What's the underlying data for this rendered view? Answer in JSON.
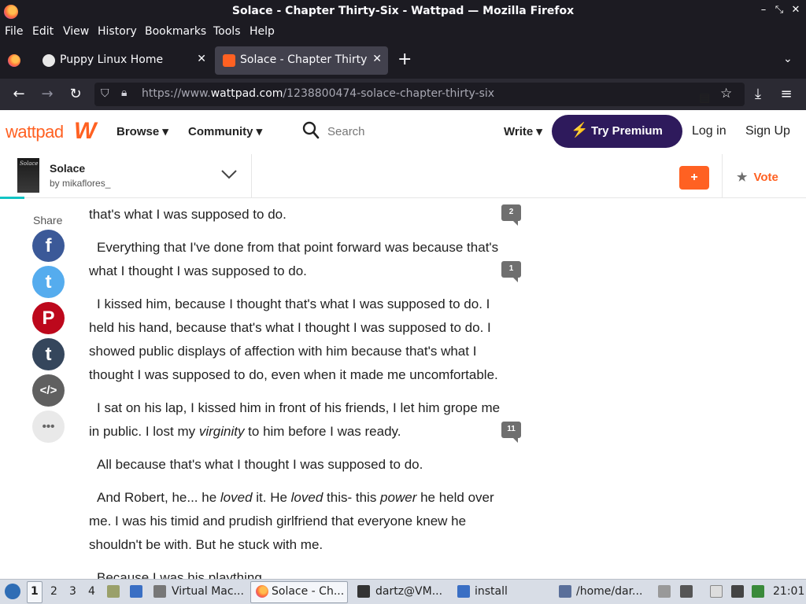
{
  "window": {
    "title": "Solace - Chapter Thirty-Six - Wattpad — Mozilla Firefox",
    "controls": {
      "minimize": "–",
      "restore": "⤡",
      "close": "✕"
    }
  },
  "menu": [
    "File",
    "Edit",
    "View",
    "History",
    "Bookmarks",
    "Tools",
    "Help"
  ],
  "tabs": [
    {
      "label": "Puppy Linux Home",
      "close": "✕"
    },
    {
      "label": "Solace - Chapter Thirty-Six",
      "close": "✕"
    }
  ],
  "tab_controls": {
    "new_tab": "+",
    "list_all": "⌄"
  },
  "nav": {
    "back": "←",
    "forward": "→",
    "reload": "↻",
    "url_prefix": "https://www.",
    "url_host": "wattpad.com",
    "url_path": "/1238800474-solace-chapter-thirty-six",
    "reader_icon": "▤",
    "bookmark_icon": "☆",
    "download": "⤓",
    "menu": "≡"
  },
  "wattpad": {
    "logo": "wattpad",
    "logo_mark": "W",
    "browse": "Browse ▾",
    "community": "Community ▾",
    "search_placeholder": "Search",
    "write": "Write ▾",
    "premium_icon": "⚡",
    "premium": "Try Premium",
    "login": "Log in",
    "signup": "Sign Up"
  },
  "story": {
    "cover_text": "Solace",
    "title": "Solace",
    "author": "by mikaflores_",
    "add": "+",
    "vote_icon": "★",
    "vote": "Vote",
    "read_progress_fraction": 0.03
  },
  "share": {
    "label": "Share",
    "buttons": [
      {
        "name": "facebook",
        "glyph": "f",
        "color": "#3b5998"
      },
      {
        "name": "twitter",
        "glyph": "t",
        "color": "#55acee"
      },
      {
        "name": "pinterest",
        "glyph": "P",
        "color": "#bd081c"
      },
      {
        "name": "tumblr",
        "glyph": "t",
        "color": "#35465c"
      },
      {
        "name": "embed",
        "glyph": "</>",
        "color": "#606060"
      },
      {
        "name": "more",
        "glyph": "•••",
        "color": "#e9e9e9"
      }
    ]
  },
  "paragraphs": [
    {
      "text": "that's what I was supposed to do.",
      "comments": "2"
    },
    {
      "text": "Everything that I've done from that point forward was because that's what I thought I was supposed to do.",
      "comments": "1"
    },
    {
      "text": "I kissed him, because I thought that's what I was supposed to do. I held his hand, because that's what I thought I was supposed to do. I showed public displays of affection with him because that's what I thought I was supposed to do, even when it made me uncomfortable.",
      "comments": ""
    },
    {
      "text_before": "I sat on his lap, I kissed him in front of his friends, I let him grope me in public. I lost my ",
      "italic": "virginity",
      "text_after": " to him before I was ready.",
      "comments": "11"
    },
    {
      "text": "All because that's what I thought I was supposed to do.",
      "comments": ""
    },
    {
      "segments": [
        "And Robert, he... he ",
        "loved",
        " it. He ",
        "loved",
        " this- this ",
        "power",
        " he held over me. I was his timid and prudish girlfriend that everyone knew he shouldn't be with. But he stuck with me."
      ],
      "comments": ""
    },
    {
      "text": "Because I was his plaything.",
      "comments": ""
    }
  ],
  "taskbar": {
    "workspaces": [
      "1",
      "2",
      "3",
      "4"
    ],
    "tasks": [
      "Virtual Mac...",
      "Solace - Ch...",
      "dartz@VM...",
      "install",
      "/home/dar..."
    ],
    "clock": "21:01"
  }
}
